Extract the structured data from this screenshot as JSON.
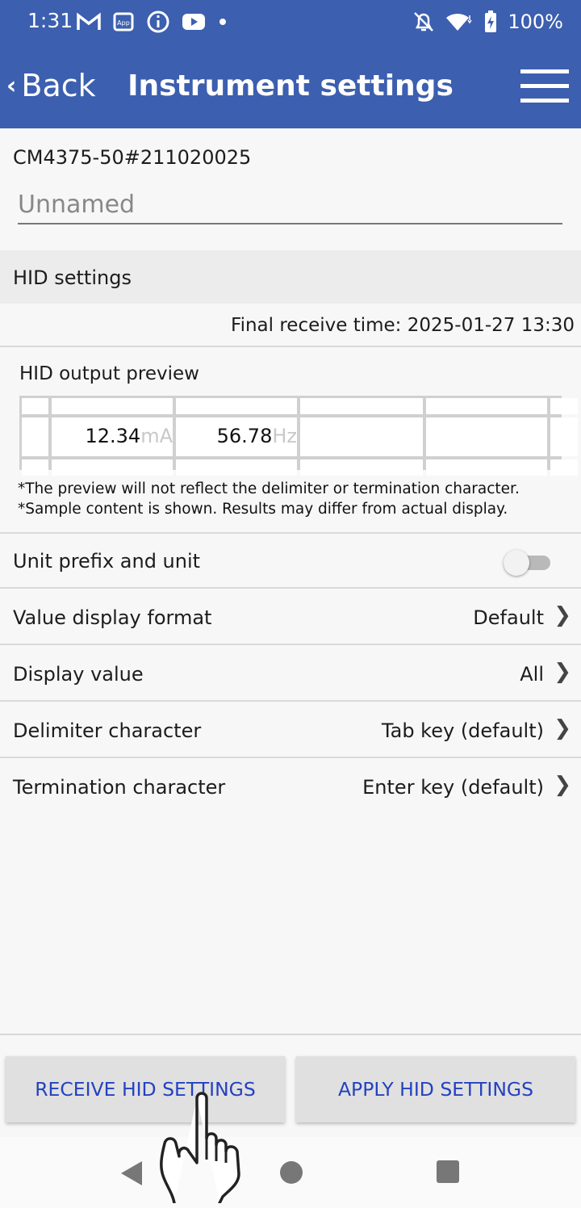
{
  "status_bar": {
    "time": "1:31",
    "battery": "100%",
    "icons_left": [
      "gmail-icon",
      "app-icon",
      "info-icon",
      "youtube-icon",
      "dot-icon"
    ],
    "icons_right": [
      "bell-off-icon",
      "wifi-icon",
      "battery-charging-icon"
    ]
  },
  "app_bar": {
    "back_label": "Back",
    "title": "Instrument settings",
    "accent": "#3c5faf"
  },
  "device": {
    "id": "CM4375-50#211020025",
    "name_placeholder": "Unnamed"
  },
  "section": {
    "title": "HID settings",
    "final_receive_time": "Final receive time: 2025-01-27 13:30"
  },
  "preview": {
    "title": "HID output preview",
    "values": [
      {
        "number": "12.34",
        "unit": "mA"
      },
      {
        "number": "56.78",
        "unit": "Hz"
      }
    ],
    "notes": [
      "*The preview will not reflect the delimiter or termination character.",
      "*Sample content is shown. Results may differ from actual display."
    ]
  },
  "settings": {
    "unit_toggle": {
      "label": "Unit prefix and unit",
      "enabled": false
    },
    "rows": [
      {
        "label": "Value display format",
        "value": "Default"
      },
      {
        "label": "Display value",
        "value": "All"
      },
      {
        "label": "Delimiter character",
        "value": "Tab key (default)"
      },
      {
        "label": "Termination character",
        "value": "Enter key (default)"
      }
    ]
  },
  "buttons": {
    "receive": "RECEIVE HID SETTINGS",
    "apply": "APPLY HID SETTINGS",
    "color": "#2441c0"
  }
}
